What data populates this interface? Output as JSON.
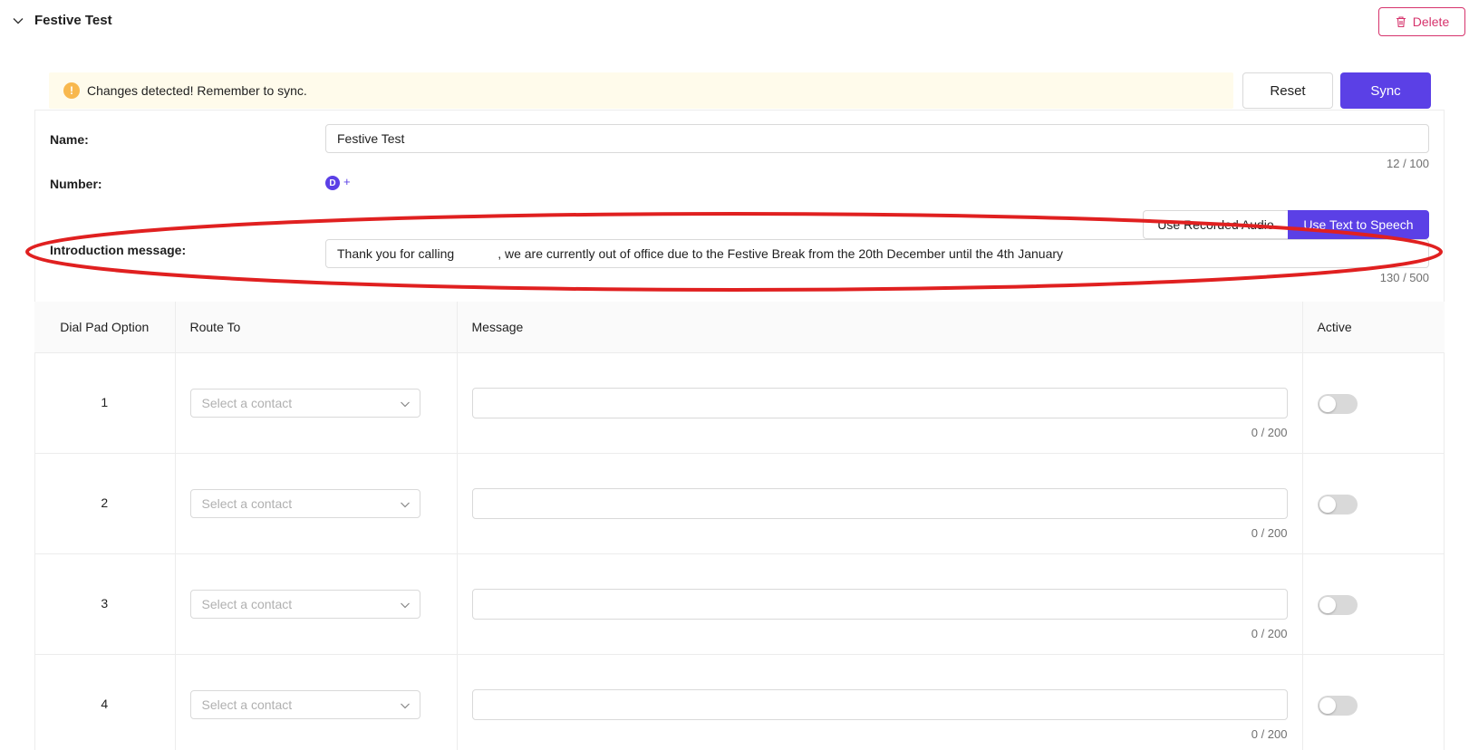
{
  "header": {
    "title": "Festive Test",
    "delete_label": "Delete"
  },
  "alert": {
    "icon": "!",
    "text": "Changes detected! Remember to sync."
  },
  "actions": {
    "reset_label": "Reset",
    "sync_label": "Sync"
  },
  "form": {
    "name_label": "Name:",
    "name_value": "Festive Test",
    "name_count": "12 / 100",
    "number_label": "Number:",
    "number_avatar": "D",
    "number_add": "+",
    "intro_label": "Introduction message:",
    "audio_mode_label": "Use Recorded Audio",
    "tts_mode_label": "Use Text to Speech",
    "intro_value_start": "Thank you for calling",
    "intro_value_end": ", we are currently out of office due to the Festive Break from the 20th December until the 4th January",
    "intro_count": "130 / 500"
  },
  "table": {
    "headers": [
      "Dial Pad Option",
      "Route To",
      "Message",
      "Active"
    ],
    "rows": [
      {
        "option": "1",
        "route_placeholder": "Select a contact",
        "message_count": "0 / 200"
      },
      {
        "option": "2",
        "route_placeholder": "Select a contact",
        "message_count": "0 / 200"
      },
      {
        "option": "3",
        "route_placeholder": "Select a contact",
        "message_count": "0 / 200"
      },
      {
        "option": "4",
        "route_placeholder": "Select a contact",
        "message_count": "0 / 200"
      }
    ]
  },
  "colors": {
    "accent": "#5b40e6",
    "delete": "#d6336c",
    "alert_bg": "#fffbeb",
    "alert_icon": "#f8b84e",
    "annotation": "#e02020"
  }
}
